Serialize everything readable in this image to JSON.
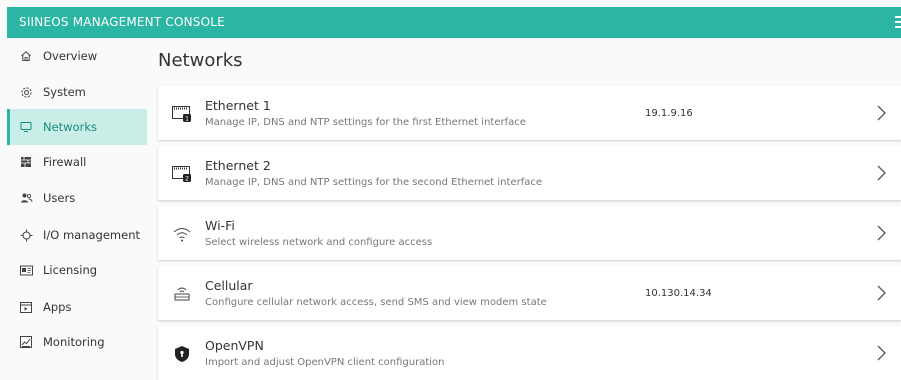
{
  "app": {
    "title": "SIINEOS MANAGEMENT CONSOLE"
  },
  "sidebar": {
    "items": [
      {
        "label": "Overview",
        "icon": "home-icon"
      },
      {
        "label": "System",
        "icon": "gear-icon"
      },
      {
        "label": "Networks",
        "icon": "monitor-icon",
        "active": true
      },
      {
        "label": "Firewall",
        "icon": "firewall-icon"
      },
      {
        "label": "Users",
        "icon": "users-icon"
      },
      {
        "label": "I/O management",
        "icon": "io-icon"
      },
      {
        "label": "Licensing",
        "icon": "license-icon"
      },
      {
        "label": "Apps",
        "icon": "apps-icon"
      },
      {
        "label": "Monitoring",
        "icon": "monitoring-icon"
      }
    ]
  },
  "main": {
    "title": "Networks",
    "cards": [
      {
        "name": "Ethernet 1",
        "description": "Manage IP, DNS and NTP settings for the first Ethernet interface",
        "ip": "19.1.9.16",
        "icon": "ethernet-1-icon"
      },
      {
        "name": "Ethernet 2",
        "description": "Manage IP, DNS and NTP settings for the second Ethernet interface",
        "ip": "",
        "icon": "ethernet-2-icon"
      },
      {
        "name": "Wi-Fi",
        "description": "Select wireless network and configure access",
        "ip": "",
        "icon": "wifi-icon"
      },
      {
        "name": "Cellular",
        "description": "Configure cellular network access, send SMS and view modem state",
        "ip": "10.130.14.34",
        "icon": "cellular-icon"
      },
      {
        "name": "OpenVPN",
        "description": "Import and adjust OpenVPN client configuration",
        "ip": "",
        "icon": "shield-icon"
      }
    ]
  },
  "colors": {
    "accent": "#2bb5a3",
    "active_bg": "#c9eee8",
    "active_text": "#1a8c7c"
  }
}
